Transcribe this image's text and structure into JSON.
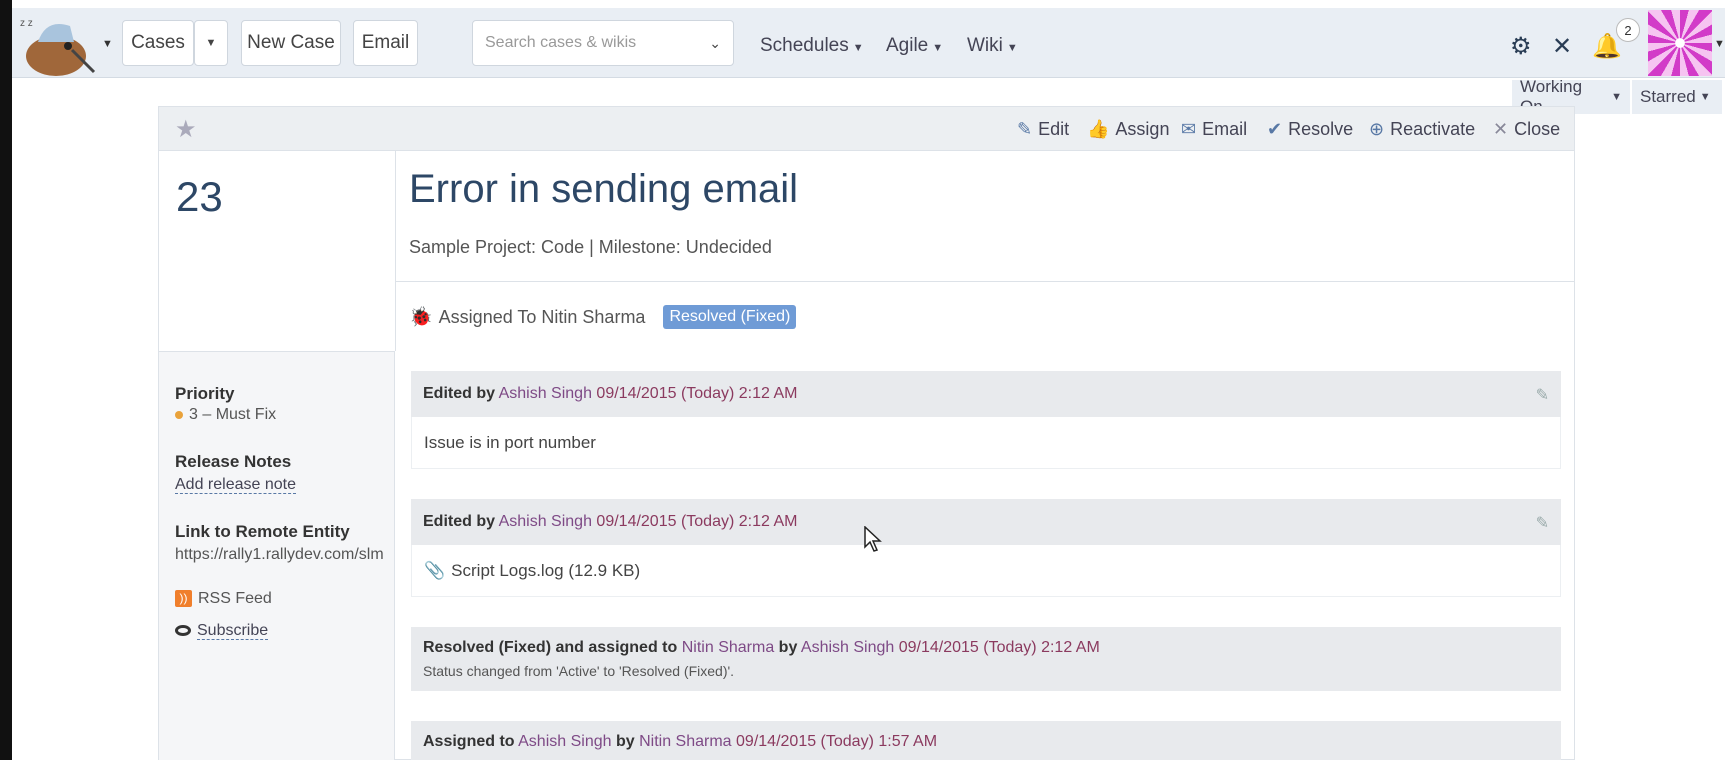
{
  "nav": {
    "cases_label": "Cases",
    "new_case_label": "New Case",
    "email_label": "Email",
    "search_placeholder": "Search cases & wikis",
    "schedules_label": "Schedules",
    "agile_label": "Agile",
    "wiki_label": "Wiki",
    "notification_count": "2",
    "working_on_label": "Working On",
    "starred_label": "Starred"
  },
  "toolbar": {
    "edit": "Edit",
    "assign": "Assign",
    "email": "Email",
    "resolve": "Resolve",
    "reactivate": "Reactivate",
    "close": "Close"
  },
  "case": {
    "number": "23",
    "title": "Error in sending email",
    "meta": "Sample Project: Code | Milestone: Undecided",
    "assigned_to": "Assigned To Nitin Sharma",
    "status": "Resolved (Fixed)"
  },
  "sidebar": {
    "priority_label": "Priority",
    "priority_value": "3 – Must Fix",
    "release_notes_label": "Release Notes",
    "add_release_note": "Add release note",
    "remote_entity_label": "Link to Remote Entity",
    "remote_entity_url": "https://rally1.rallydev.com/slm",
    "rss_feed": "RSS Feed",
    "subscribe": "Subscribe"
  },
  "events": [
    {
      "prefix": "Edited by",
      "person": "Ashish Singh",
      "date": "09/14/2015 (Today) 2:12 AM",
      "body": "Issue is in port number"
    },
    {
      "prefix": "Edited by",
      "person": "Ashish Singh",
      "date": "09/14/2015 (Today) 2:12 AM",
      "attachment": "Script Logs.log (12.9 KB)"
    },
    {
      "prefix": "Resolved (Fixed) and assigned to",
      "person": "Nitin Sharma",
      "by": "by",
      "by_person": "Ashish Singh",
      "date": "09/14/2015 (Today) 2:12 AM",
      "sub": "Status changed from 'Active' to 'Resolved (Fixed)'."
    },
    {
      "prefix": "Assigned to",
      "person": "Ashish Singh",
      "by": "by",
      "by_person": "Nitin Sharma",
      "date": "09/14/2015 (Today) 1:57 AM"
    }
  ]
}
